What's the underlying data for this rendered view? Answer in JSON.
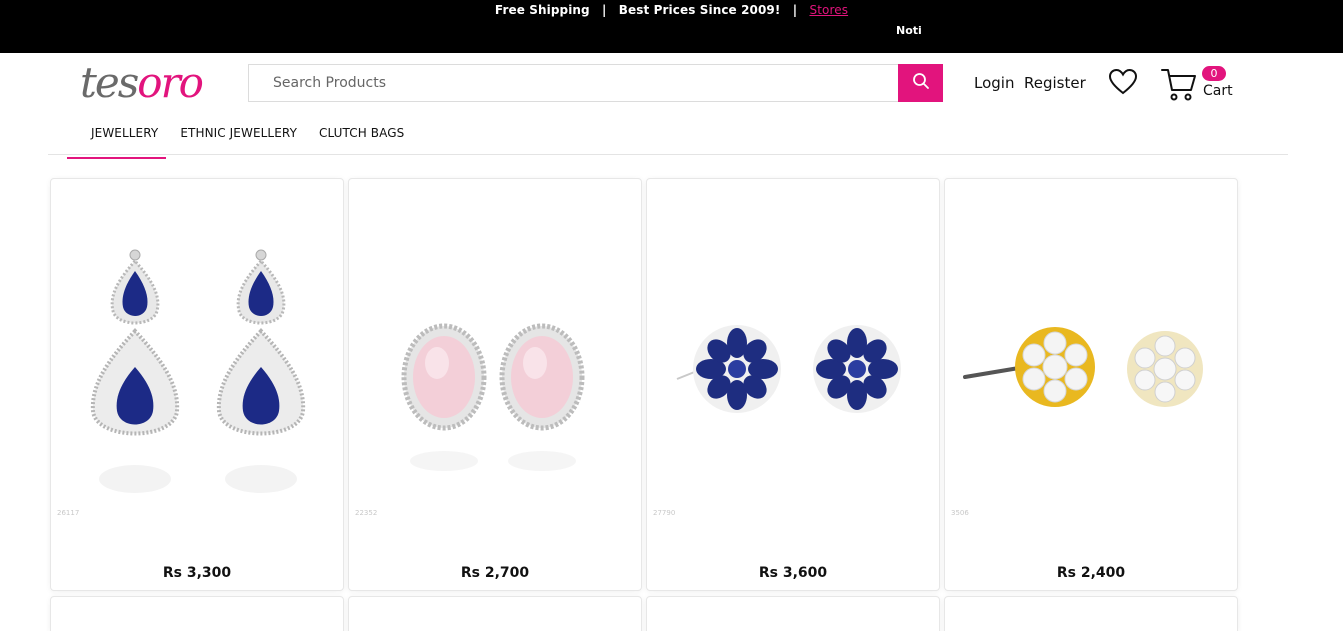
{
  "topbar": {
    "free_shipping": "Free Shipping",
    "separator": "|",
    "best_prices": "Best Prices Since 2009!",
    "stores_link": "Stores",
    "ticker": "Noti"
  },
  "header": {
    "logo_part1": "tes",
    "logo_part2": "oro",
    "search_placeholder": "Search Products",
    "login": "Login",
    "register": "Register",
    "cart_count": "0",
    "cart_label": "Cart"
  },
  "nav": {
    "items": [
      "JEWELLERY",
      "ETHNIC JEWELLERY",
      "CLUTCH BAGS"
    ]
  },
  "products": [
    {
      "sku": "26117",
      "price": "Rs 3,300",
      "icon": "sapphire-drop-earrings"
    },
    {
      "sku": "22352",
      "price": "Rs 2,700",
      "icon": "pink-oval-stud-earrings"
    },
    {
      "sku": "27790",
      "price": "Rs 3,600",
      "icon": "blue-flower-stud-earrings"
    },
    {
      "sku": "3506",
      "price": "Rs 2,400",
      "icon": "gold-cluster-stud-earrings"
    }
  ],
  "colors": {
    "brand_pink": "#e2147d",
    "topbar_bg": "#000000",
    "logo_grey": "#6a6a6a"
  }
}
